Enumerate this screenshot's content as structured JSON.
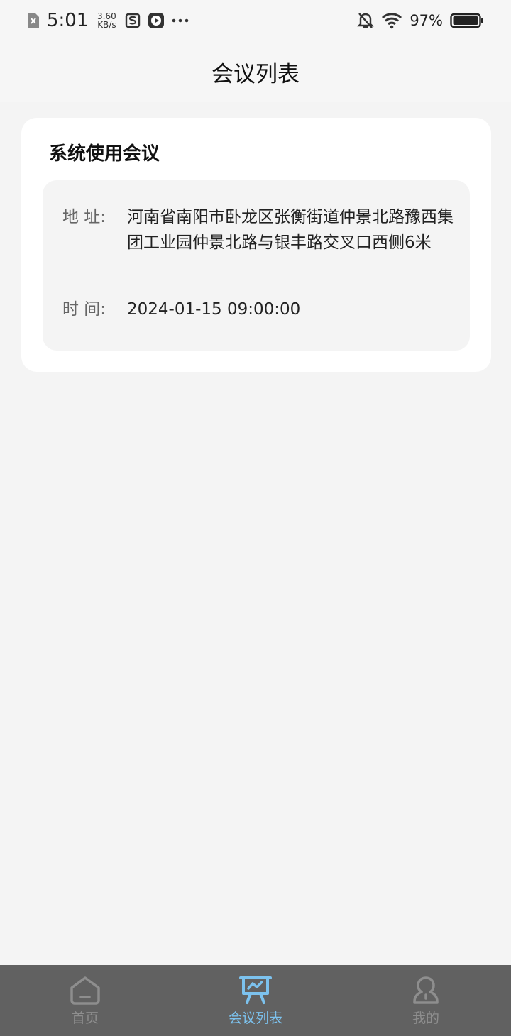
{
  "status_bar": {
    "time": "5:01",
    "speed_value": "3.60",
    "speed_unit": "KB/s",
    "battery": "97%"
  },
  "header": {
    "title": "会议列表"
  },
  "meeting": {
    "title": "系统使用会议",
    "address_label": "地 址:",
    "address": "河南省南阳市卧龙区张衡街道仲景北路豫西集团工业园仲景北路与银丰路交叉口西侧6米",
    "time_label": "时 间:",
    "time": "2024-01-15 09:00:00"
  },
  "tabbar": {
    "tabs": [
      {
        "label": "首页",
        "icon": "home-icon",
        "active": false
      },
      {
        "label": "会议列表",
        "icon": "presentation-icon",
        "active": true
      },
      {
        "label": "我的",
        "icon": "user-icon",
        "active": false
      }
    ],
    "active_color": "#7cc2ee",
    "inactive_color": "#8e8e8e"
  }
}
